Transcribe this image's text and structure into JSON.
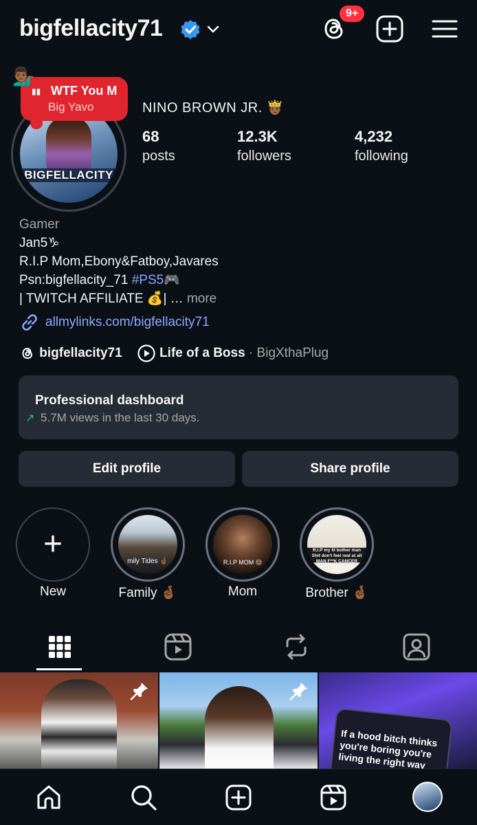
{
  "header": {
    "username": "bigfellacity71",
    "notification_badge": "9+"
  },
  "note": {
    "emoji": "💁🏾‍♂️",
    "bars": "▮▮",
    "title": "WTF You M",
    "subtitle": "Big Yavo"
  },
  "avatar": {
    "label": "BIGFELLACITY"
  },
  "profile": {
    "display_name": "NINO BROWN JR. 🤴🏾",
    "stats": [
      {
        "value": "68",
        "label": "posts"
      },
      {
        "value": "12.3K",
        "label": "followers"
      },
      {
        "value": "4,232",
        "label": "following"
      }
    ]
  },
  "bio": {
    "category": "Gamer",
    "line1": "Jan5♑",
    "line2": "R.I.P Mom,Ebony&Fatboy,Javares",
    "line3_prefix": "Psn:bigfellacity_71 ",
    "line3_tag": "#PS5",
    "line3_suffix": "🎮",
    "line4": "| TWITCH AFFILIATE 💰| …",
    "more": "more",
    "link": "allmylinks.com/bigfellacity71"
  },
  "threads_row": {
    "handle": "bigfellacity71",
    "music_title": "Life of a Boss",
    "separator": " · ",
    "artist": "BigXthaPlug"
  },
  "dashboard": {
    "title": "Professional dashboard",
    "arrow": "↗",
    "subtitle": "5.7M views in the last 30 days."
  },
  "buttons": {
    "edit": "Edit profile",
    "share": "Share profile"
  },
  "highlights": [
    {
      "label": "New"
    },
    {
      "label": "Family 🤞🏾",
      "caption": "mily Tides 🤞🏾"
    },
    {
      "label": "Mom",
      "caption": "R.I.P MOM 😔"
    },
    {
      "label": "Brother 🤞🏾",
      "caption": "R.I.P my lil bother man Shit don't feel real at all MAN F**K CANCER"
    }
  ],
  "posts": [
    {
      "type": "pinned"
    },
    {
      "type": "pinned"
    },
    {
      "caption": "If a hood bitch thinks you're boring you're living the right way"
    }
  ],
  "colors": {
    "background": "#0b1016",
    "card": "#262c35",
    "link": "#8ea8ff",
    "badge": "#ff3040",
    "note": "#e0252f",
    "trend": "#2ec27e"
  }
}
